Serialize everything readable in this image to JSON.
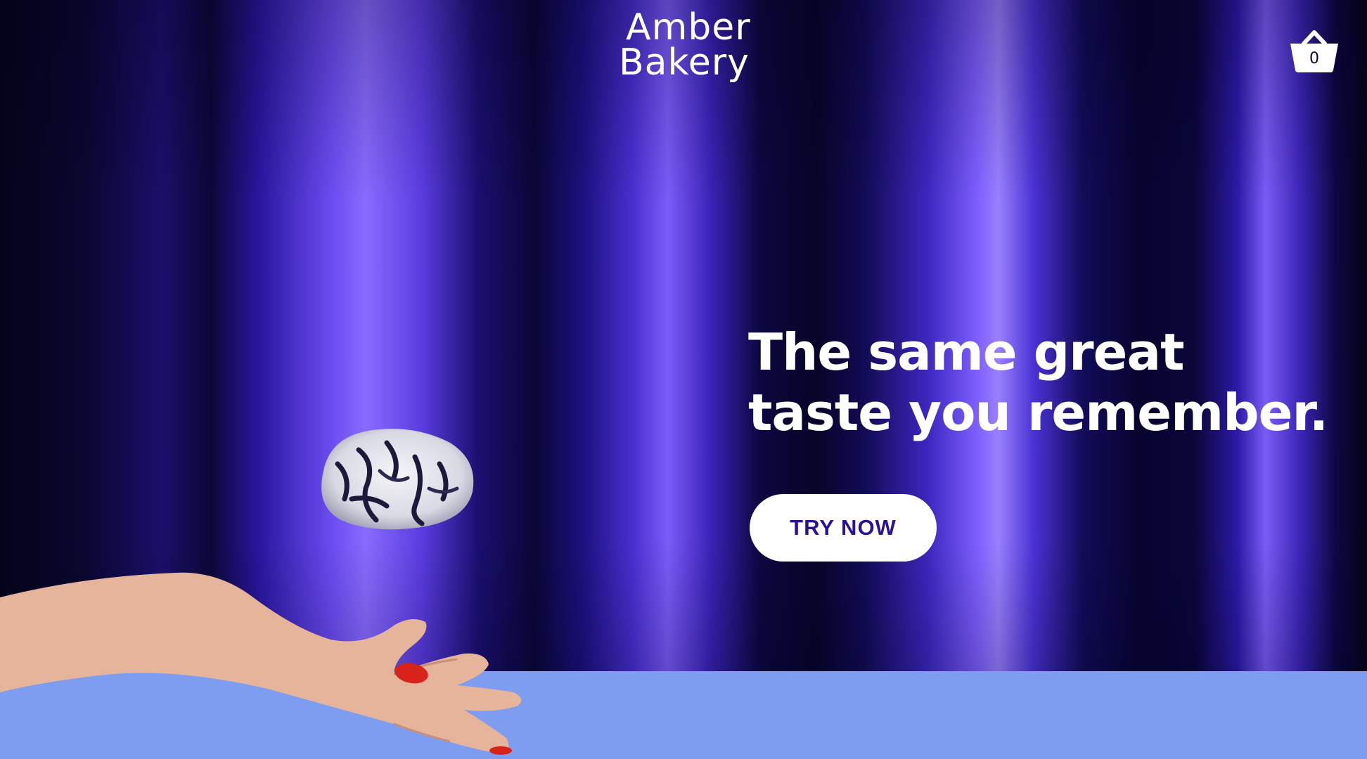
{
  "brand": {
    "logo_line1": "Amber",
    "logo_line2": "Bakery"
  },
  "cart": {
    "icon": "basket-icon",
    "count": "0"
  },
  "hero": {
    "headline_line1": "The same great",
    "headline_line2": "taste you remember.",
    "cta_label": "TRY NOW"
  },
  "colors": {
    "curtain": "#5a3ce0",
    "table": "#7f9df0",
    "cta_background": "#ffffff",
    "cta_text": "#2c1290",
    "nail_polish": "#d8231b"
  }
}
